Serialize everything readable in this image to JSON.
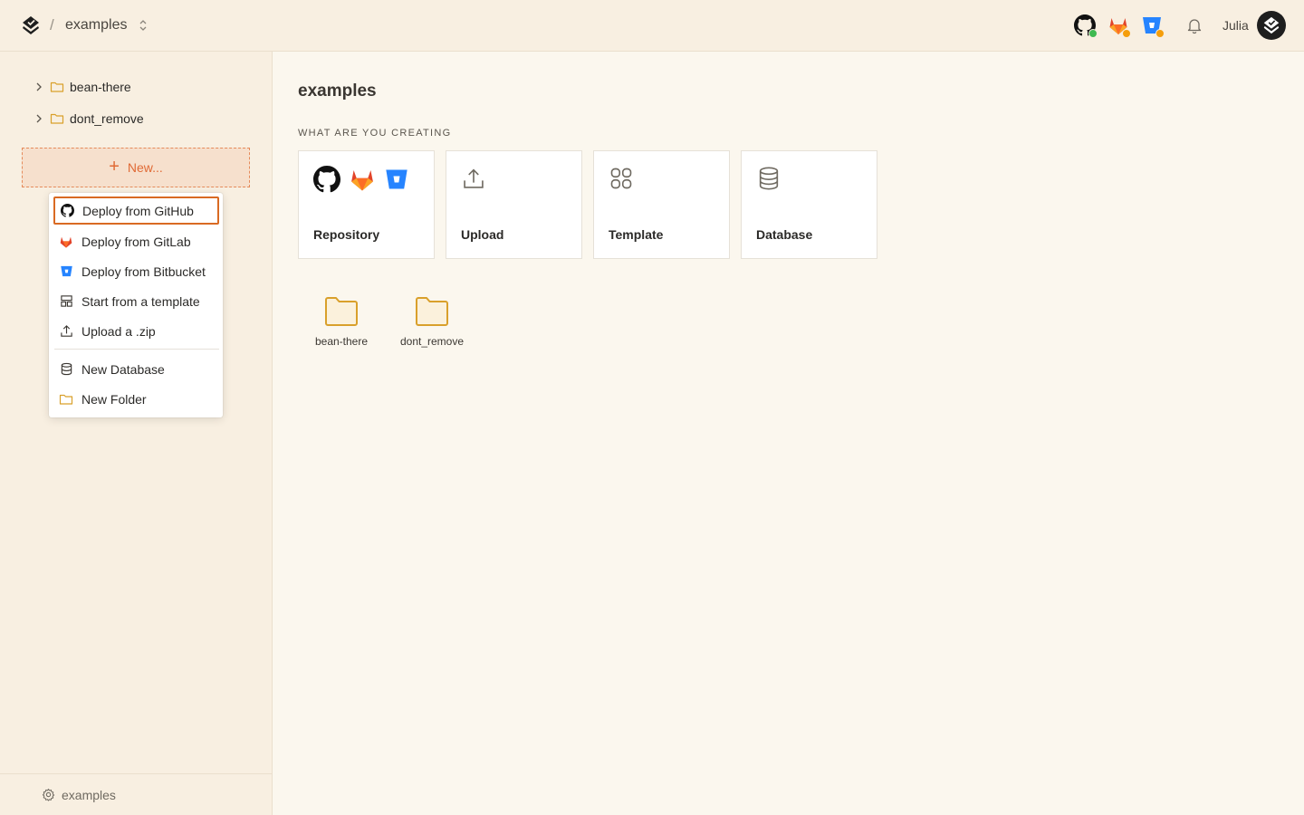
{
  "topbar": {
    "separator": "/",
    "project": "examples",
    "username": "Julia",
    "github_status_color": "#3fb950",
    "gitlab_status_color": "#f59e0b",
    "bitbucket_status_color": "#f59e0b"
  },
  "sidebar": {
    "tree": [
      {
        "label": "bean-there"
      },
      {
        "label": "dont_remove"
      }
    ],
    "new_button": "New...",
    "footer_label": "examples"
  },
  "menu": {
    "items": [
      {
        "label": "Deploy from GitHub",
        "icon": "github-icon",
        "active": true
      },
      {
        "label": "Deploy from GitLab",
        "icon": "gitlab-icon"
      },
      {
        "label": "Deploy from Bitbucket",
        "icon": "bitbucket-icon"
      },
      {
        "label": "Start from a template",
        "icon": "template-icon"
      },
      {
        "label": "Upload a .zip",
        "icon": "upload-icon"
      },
      {
        "label": "New Database",
        "icon": "database-icon"
      },
      {
        "label": "New Folder",
        "icon": "folder-icon"
      }
    ]
  },
  "main": {
    "title": "examples",
    "section_label": "WHAT ARE YOU CREATING",
    "cards": [
      {
        "label": "Repository"
      },
      {
        "label": "Upload"
      },
      {
        "label": "Template"
      },
      {
        "label": "Database"
      }
    ],
    "folders": [
      {
        "label": "bean-there"
      },
      {
        "label": "dont_remove"
      }
    ]
  },
  "colors": {
    "accent": "#e06a35",
    "active_outline": "#d96a23",
    "folder": "#d9a02b",
    "sidebar_bg": "#f8efe1",
    "main_bg": "#fbf7ee"
  }
}
